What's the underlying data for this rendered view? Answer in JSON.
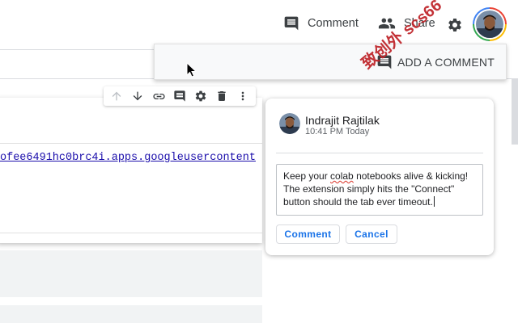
{
  "header": {
    "comment_label": "Comment",
    "share_label": "Share",
    "icons": [
      "comment-icon",
      "people-icon",
      "gear-icon",
      "avatar"
    ]
  },
  "add_comment_menu": {
    "label": "ADD A COMMENT"
  },
  "cell": {
    "output_link": "ofee6491hc0brc4i.apps.googleusercontent",
    "toolbar_icons": [
      "arrow-up-icon",
      "arrow-down-icon",
      "link-icon",
      "comment-icon",
      "gear-icon",
      "delete-icon",
      "more-vert-icon"
    ]
  },
  "comment_dialog": {
    "author": "Indrajit Rajtilak",
    "time": "10:41 PM Today",
    "text_before": "Keep your ",
    "text_misspelled": "colab",
    "text_after": " notebooks alive & kicking!\nThe extension simply hits the \"Connect\"\nbutton should the tab ever timeout.",
    "submit_label": "Comment",
    "cancel_label": "Cancel"
  },
  "watermark": "致创外 scs66",
  "colors": {
    "accent": "#1a73e8",
    "text": "#202124",
    "secondary_text": "#5f6368",
    "watermark": "#c0282d"
  }
}
